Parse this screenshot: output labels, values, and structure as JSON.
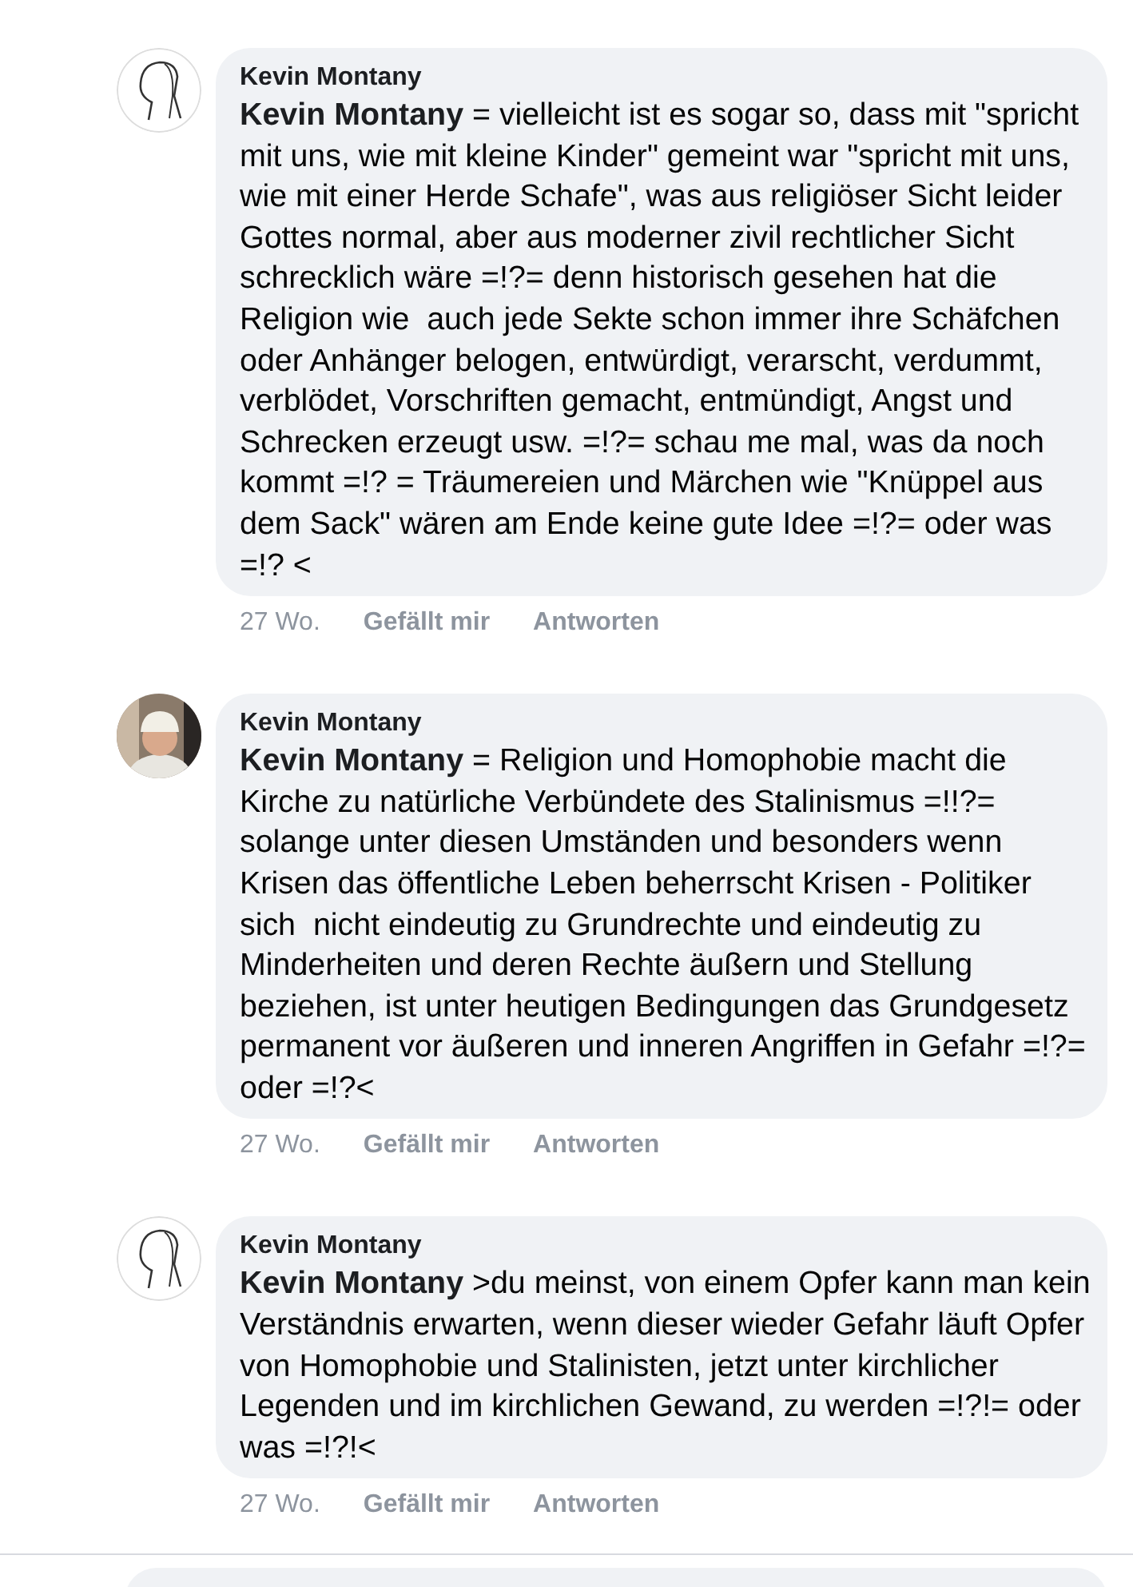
{
  "comments": [
    {
      "avatar": {
        "kind": "sketch"
      },
      "author": "Kevin Montany",
      "text": "**Kevin Montany** = vielleicht ist es sogar so, dass mit \"spricht mit uns, wie mit kleine Kinder\" gemeint war \"spricht mit uns, wie mit einer Herde Schafe\", was aus religiöser Sicht leider Gottes normal, aber aus moderner zivil rechtlicher Sicht schrecklich wäre =!?= denn historisch gesehen hat die Religion wie  auch jede Sekte schon immer ihre Schäfchen oder Anhänger belogen, entwürdigt, verarscht, verdummt, verblödet, Vorschriften gemacht, entmündigt, Angst und Schrecken erzeugt usw. =!?= schau me mal, was da noch kommt =!? = Träumereien und Märchen wie \"Knüppel aus dem Sack\" wären am Ende keine gute Idee =!?= oder was =!? <",
      "time": "27 Wo.",
      "like": "Gefällt mir",
      "reply": "Antworten"
    },
    {
      "author": "Kevin Montany",
      "text": "**Kevin Montany** = Religion und Homophobie macht die Kirche zu natürliche Verbündete des Stalinismus =!!?= solange unter diesen Umständen und besonders wenn Krisen das öffentliche Leben beherrscht Krisen - Politiker sich  nicht eindeutig zu Grundrechte und eindeutig zu Minderheiten und deren Rechte äußern und Stellung beziehen, ist unter heutigen Bedingungen das Grundgesetz permanent vor äußeren und inneren Angriffen in Gefahr =!?= oder =!?<",
      "time": "27 Wo.",
      "like": "Gefällt mir",
      "reply": "Antworten"
    },
    {
      "avatar": {
        "kind": "sketch"
      },
      "author": "Kevin Montany",
      "text": "**Kevin Montany** >du meinst, von einem Opfer kann man kein Verständnis erwarten, wenn dieser wieder Gefahr läuft Opfer von Homophobie und Stalinisten, jetzt unter kirchlicher Legenden und im kirchlichen Gewand, zu werden =!?!= oder was =!?!<",
      "time": "27 Wo.",
      "like": "Gefällt mir",
      "reply": "Antworten"
    }
  ]
}
